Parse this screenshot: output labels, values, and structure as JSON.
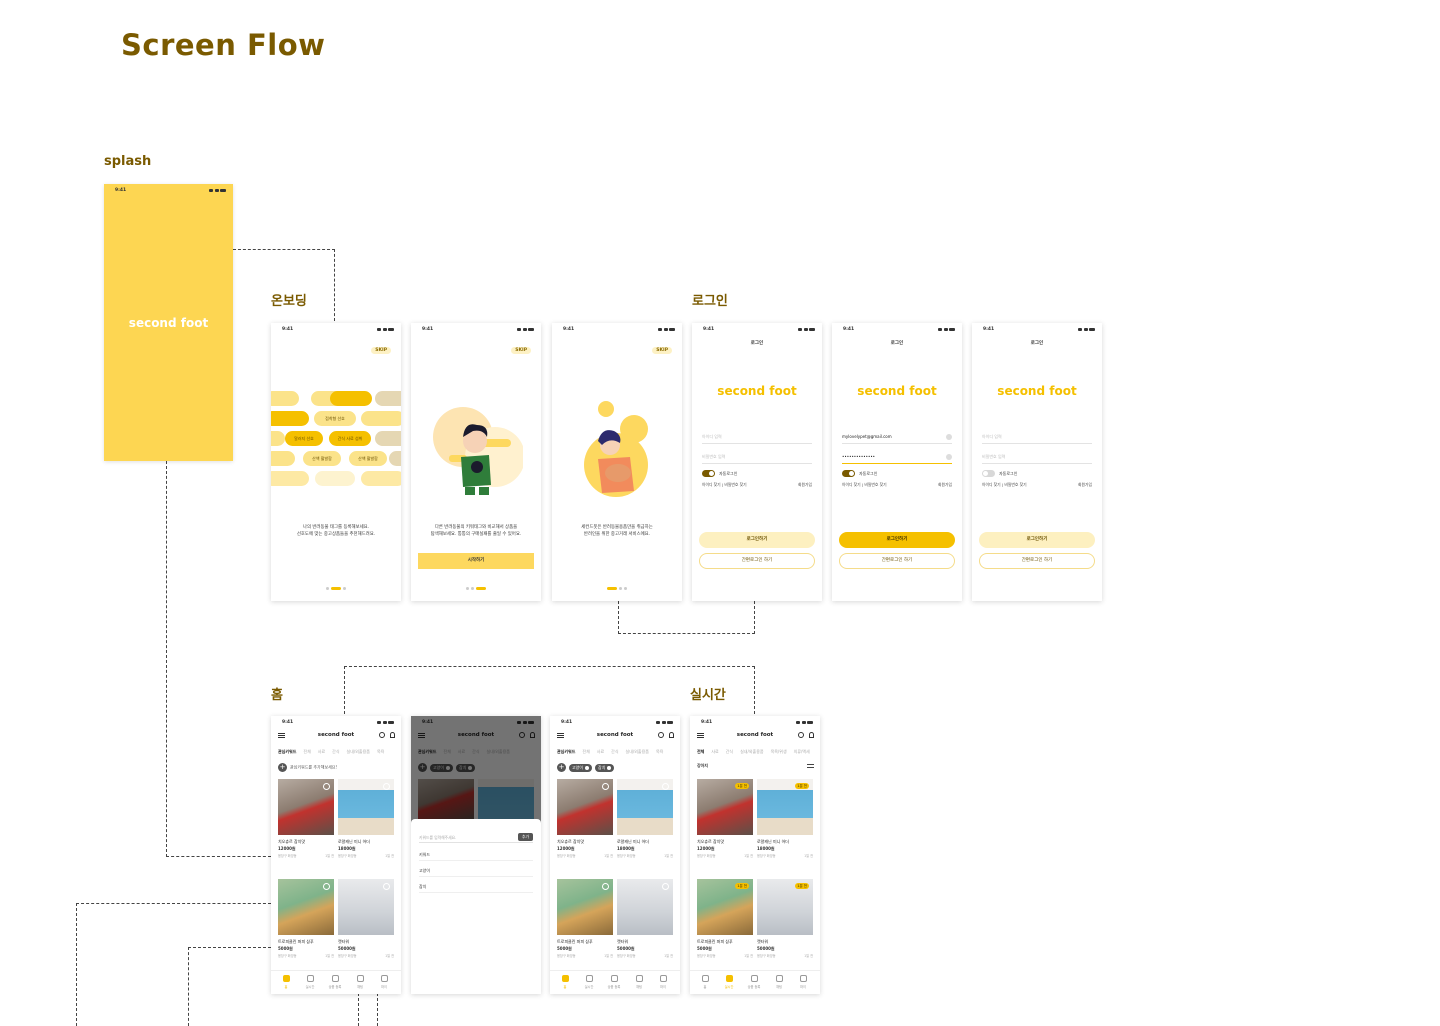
{
  "page": {
    "title": "Screen Flow"
  },
  "colors": {
    "accent": "#f5c000",
    "splash_bg": "#fdd652",
    "title_color": "#7a5a00"
  },
  "sections": {
    "splash": "splash",
    "onboarding": "온보딩",
    "login": "로그인",
    "home": "홈",
    "realtime": "실시간"
  },
  "status_time": "9:41",
  "logo": "second foot",
  "onboarding": {
    "skip": "SKIP",
    "screen1": {
      "text_line1": "나의 반려동물 태그를 등록해보세요.",
      "text_line2": "선호도에 맞는 중고상품들을 추천해드려요.",
      "pills": [
        "점착형 선호",
        "알러지 선호",
        "간식 사료 섭취",
        "산책 활발함",
        "산책 활발함"
      ]
    },
    "screen2": {
      "text_line1": "다른 반려동물의 키워태그와 비교해서 상품을",
      "text_line2": "탐색해보세요. 통통의 구매실패를 줄일 수 있어요.",
      "start": "시작하기"
    },
    "screen3": {
      "text_line1": "세컨드풋은 반려동물용품만을 취급하는",
      "text_line2": "반려인을 위한 중고거래 서비스에요."
    }
  },
  "login": {
    "header": "로그인",
    "id_placeholder": "아이디 입력",
    "pw_placeholder": "비밀번호 입력",
    "email_value": "mylovelypet@gmail.com",
    "password_value": "••••••••••••••",
    "auto_login": "자동로그인",
    "find_id": "아이디 찾기",
    "find_pw": "비밀번호 찾기",
    "signup": "회원가입",
    "login_button": "로그인하기",
    "simple_login": "간편로그인 하기"
  },
  "home": {
    "tabs": [
      "관심키워드",
      "전체",
      "사료",
      "간식",
      "실내/외출용품",
      "목욕"
    ],
    "keyword_prompt": "관심키워드를 추가해보세요!",
    "chips": [
      "고양이",
      "참치"
    ],
    "sheet": {
      "placeholder": "키워드를 입력해주세요.",
      "add": "추가",
      "items": [
        "키워드",
        "고양이",
        "참치"
      ]
    },
    "nav": [
      "홈",
      "실시간",
      "상품 등록",
      "채팅",
      "마이"
    ]
  },
  "realtime": {
    "tabs": [
      "전체",
      "사료",
      "간식",
      "실내/외출용품",
      "목욕/위생",
      "의류/액세"
    ],
    "category": "강아지",
    "badge": "1분 전"
  },
  "products": [
    {
      "title": "치오츄르 참치맛",
      "price": "12000원",
      "meta": "용장구 화양동",
      "ago": "1일 전"
    },
    {
      "title": "로얄캐닌 미니 어더",
      "price": "18000원",
      "meta": "용장구 화양동",
      "ago": "1일 전"
    },
    {
      "title": "트로피클린 퍼피 샴푸",
      "price": "5000원",
      "meta": "용장구 화양동",
      "ago": "1일 전"
    },
    {
      "title": "캣타워",
      "price": "50000원",
      "meta": "용장구 화양동",
      "ago": "1일 전"
    }
  ]
}
